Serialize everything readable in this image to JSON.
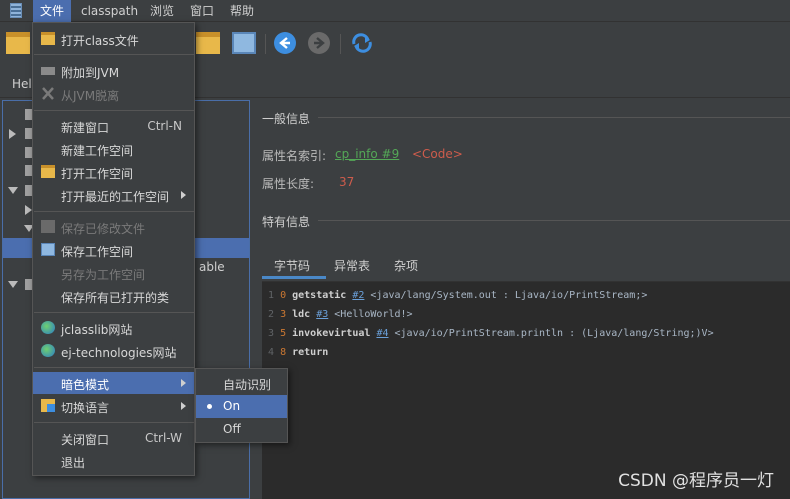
{
  "menubar": {
    "items": [
      "文件",
      "classpath",
      "浏览",
      "窗口",
      "帮助"
    ]
  },
  "tab": {
    "label": "Hel"
  },
  "tree": {
    "partial_text": "able"
  },
  "general": {
    "title": "一般信息",
    "name_index_label": "属性名索引:",
    "name_index_link": "cp_info #9",
    "name_index_value": "<Code>",
    "length_label": "属性长度:",
    "length_value": "37"
  },
  "specific": {
    "title": "特有信息"
  },
  "subtabs": [
    "字节码",
    "异常表",
    "杂项"
  ],
  "code": [
    {
      "line": "1",
      "offset": "0",
      "op": "getstatic",
      "ref": "#2",
      "rest": " <java/lang/System.out : Ljava/io/PrintStream;>"
    },
    {
      "line": "2",
      "offset": "3",
      "op": "ldc",
      "ref": "#3",
      "rest": " <HelloWorld!>"
    },
    {
      "line": "3",
      "offset": "5",
      "op": "invokevirtual",
      "ref": "#4",
      "rest": " <java/io/PrintStream.println : (Ljava/lang/String;)V>"
    },
    {
      "line": "4",
      "offset": "8",
      "op": "return",
      "ref": "",
      "rest": ""
    }
  ],
  "file_menu": {
    "open_class": "打开class文件",
    "attach_jvm": "附加到JVM",
    "detach_jvm": "从JVM脱离",
    "new_window": "新建窗口",
    "new_window_shortcut": "Ctrl-N",
    "new_workspace": "新建工作空间",
    "open_workspace": "打开工作空间",
    "open_recent": "打开最近的工作空间",
    "save_modified": "保存已修改文件",
    "save_workspace": "保存工作空间",
    "save_as_workspace": "另存为工作空间",
    "save_all": "保存所有已打开的类",
    "jclasslib_site": "jclasslib网站",
    "ej_site": "ej-technologies网站",
    "dark_mode": "暗色模式",
    "switch_lang": "切换语言",
    "close_window": "关闭窗口",
    "close_window_shortcut": "Ctrl-W",
    "exit": "退出"
  },
  "dark_submenu": {
    "items": [
      "自动识别",
      "On",
      "Off"
    ],
    "selected": "On"
  },
  "watermark": "CSDN @程序员一灯",
  "colors": {
    "accent": "#4b6eaf",
    "link": "#54a857",
    "code_tag": "#ce5c4c",
    "bg": "#3c3f41"
  }
}
